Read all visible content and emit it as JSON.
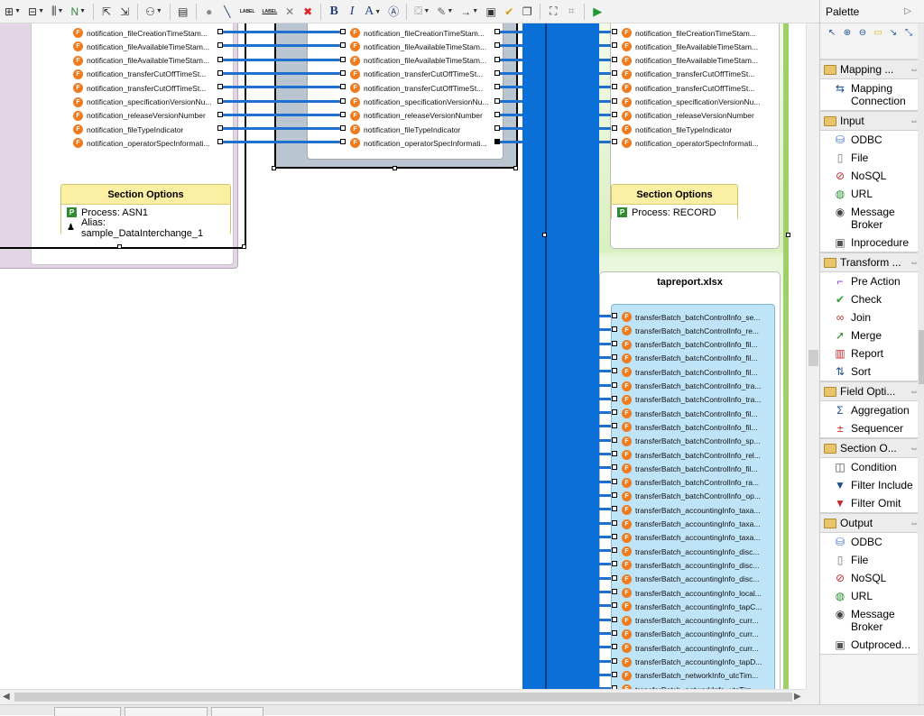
{
  "left_fields": [
    "notification_fileCreationTimeStam...",
    "notification_fileAvailableTimeStam...",
    "notification_fileAvailableTimeStam...",
    "notification_transferCutOffTimeSt...",
    "notification_transferCutOffTimeSt...",
    "notification_specificationVersionNu...",
    "notification_releaseVersionNumber",
    "notification_fileTypeIndicator",
    "notification_operatorSpecInformati..."
  ],
  "middle_fields": [
    "notification_fileCreationTimeStam...",
    "notification_fileAvailableTimeStam...",
    "notification_fileAvailableTimeStam...",
    "notification_transferCutOffTimeSt...",
    "notification_transferCutOffTimeSt...",
    "notification_specificationVersionNu...",
    "notification_releaseVersionNumber",
    "notification_fileTypeIndicator",
    "notification_operatorSpecInformati..."
  ],
  "right_top_fields": [
    "notification_fileCreationTimeStam...",
    "notification_fileAvailableTimeStam...",
    "notification_fileAvailableTimeStam...",
    "notification_transferCutOffTimeSt...",
    "notification_transferCutOffTimeSt...",
    "notification_specificationVersionNu...",
    "notification_releaseVersionNumber",
    "notification_fileTypeIndicator",
    "notification_operatorSpecInformati..."
  ],
  "section_options_left": {
    "title": "Section Options",
    "process": "Process: ASN1",
    "alias": "Alias: sample_DataInterchange_1"
  },
  "section_options_right": {
    "title": "Section Options",
    "process": "Process: RECORD"
  },
  "tapreport": {
    "title": "tapreport.xlsx",
    "fields": [
      "transferBatch_batchControlInfo_se...",
      "transferBatch_batchControlInfo_re...",
      "transferBatch_batchControlInfo_fil...",
      "transferBatch_batchControlInfo_fil...",
      "transferBatch_batchControlInfo_fil...",
      "transferBatch_batchControlInfo_tra...",
      "transferBatch_batchControlInfo_tra...",
      "transferBatch_batchControlInfo_fil...",
      "transferBatch_batchControlInfo_fil...",
      "transferBatch_batchControlInfo_sp...",
      "transferBatch_batchControlInfo_rel...",
      "transferBatch_batchControlInfo_fil...",
      "transferBatch_batchControlInfo_ra...",
      "transferBatch_batchControlInfo_op...",
      "transferBatch_accountingInfo_taxa...",
      "transferBatch_accountingInfo_taxa...",
      "transferBatch_accountingInfo_taxa...",
      "transferBatch_accountingInfo_disc...",
      "transferBatch_accountingInfo_disc...",
      "transferBatch_accountingInfo_disc...",
      "transferBatch_accountingInfo_local...",
      "transferBatch_accountingInfo_tapC...",
      "transferBatch_accountingInfo_curr...",
      "transferBatch_accountingInfo_curr...",
      "transferBatch_accountingInfo_curr...",
      "transferBatch_accountingInfo_tapD...",
      "transferBatch_networkInfo_utcTim...",
      "transferBatch_networkInfo_utcTim..."
    ]
  },
  "palette": {
    "title": "Palette",
    "drawers": [
      {
        "name": "Mapping ...",
        "items": [
          {
            "label": "Mapping Connection",
            "icon": "mapping-connection-icon"
          }
        ]
      },
      {
        "name": "Input",
        "items": [
          {
            "label": "ODBC",
            "icon": "odbc-icon"
          },
          {
            "label": "File",
            "icon": "file-icon"
          },
          {
            "label": "NoSQL",
            "icon": "nosql-icon"
          },
          {
            "label": "URL",
            "icon": "url-icon"
          },
          {
            "label": "Message Broker",
            "icon": "message-broker-icon"
          },
          {
            "label": "Inprocedure",
            "icon": "inprocedure-icon"
          }
        ]
      },
      {
        "name": "Transform ...",
        "items": [
          {
            "label": "Pre Action",
            "icon": "pre-action-icon"
          },
          {
            "label": "Check",
            "icon": "check-icon"
          },
          {
            "label": "Join",
            "icon": "join-icon"
          },
          {
            "label": "Merge",
            "icon": "merge-icon"
          },
          {
            "label": "Report",
            "icon": "report-icon"
          },
          {
            "label": "Sort",
            "icon": "sort-icon"
          }
        ]
      },
      {
        "name": "Field Opti...",
        "items": [
          {
            "label": "Aggregation",
            "icon": "aggregation-icon"
          },
          {
            "label": "Sequencer",
            "icon": "sequencer-icon"
          }
        ]
      },
      {
        "name": "Section O...",
        "items": [
          {
            "label": "Condition",
            "icon": "condition-icon"
          },
          {
            "label": "Filter Include",
            "icon": "filter-include-icon"
          },
          {
            "label": "Filter Omit",
            "icon": "filter-omit-icon"
          }
        ]
      },
      {
        "name": "Output",
        "items": [
          {
            "label": "ODBC",
            "icon": "odbc-icon"
          },
          {
            "label": "File",
            "icon": "file-icon"
          },
          {
            "label": "NoSQL",
            "icon": "nosql-icon"
          },
          {
            "label": "URL",
            "icon": "url-icon"
          },
          {
            "label": "Message Broker",
            "icon": "message-broker-icon"
          },
          {
            "label": "Outproced...",
            "icon": "outprocedure-icon"
          }
        ]
      }
    ]
  },
  "toolbar": {
    "bold_label": "B",
    "italic_label": "I",
    "font_color_label": "A",
    "label_text_1": "LABEL",
    "label_text_2": "LABEL",
    "icons": [
      "layout-icon",
      "align-icon",
      "columns-icon",
      "chart-icon",
      "export-icon",
      "import-icon",
      "hierarchy-icon",
      "page-icon",
      "dot-icon",
      "line-icon",
      "label-icon",
      "label-icon",
      "delete-icon",
      "delete-all-icon",
      "bold-icon",
      "italic-icon",
      "font-color-icon",
      "text-style-icon",
      "fill-color-icon",
      "line-color-icon",
      "arrow-icon",
      "select-icon",
      "check-icon",
      "copy-icon",
      "zoom-fit-icon",
      "snap-icon",
      "run-icon"
    ]
  },
  "colors": {
    "connector": "#1e6fd0",
    "blue_column": "#0a6fd6",
    "field_icon": "#ef7b1e",
    "section_options_header": "#fbefa4",
    "tapreport_fields_bg": "#bfe3f7",
    "green_panel": "#d9f0c0",
    "purple_panel": "#e3d5e5"
  }
}
